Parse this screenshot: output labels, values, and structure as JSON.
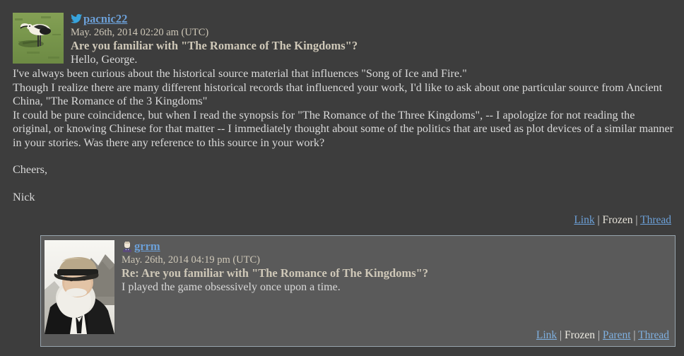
{
  "theme": {
    "page_background": "#3d3d3d",
    "reply_background": "#5a5a5a",
    "reply_border": "#97a4ad",
    "link_color": "#6ca0d8",
    "text_color": "#d9d9d9",
    "meta_color": "#cfc8b8"
  },
  "top_comment": {
    "avatar_alt": "bird-on-grass-userpic",
    "user_icon": "twitter-bird-icon",
    "username": "pacnic22",
    "datetime": "May. 26th, 2014 02:20 am (UTC)",
    "subject": "Are you familiar with \"The Romance of The Kingdoms\"?",
    "greeting": "Hello, George.",
    "body_lines": [
      "I've always been curious about the historical source material that influences \"Song of Ice and Fire.\"",
      "Though I realize there are many different historical records that influenced your work, I'd like to ask about one particular source from Ancient China, \"The Romance of the 3 Kingdoms\"",
      "It could be pure coincidence, but when I read the synopsis for \"The Romance of the Three Kingdoms\", -- I apologize for not reading the original, or knowing Chinese for that matter -- I immediately thought about some of the politics that are used as plot devices of a similar manner in your stories. Was there any reference to this source in your work?"
    ],
    "signoff": "Cheers,",
    "signature": "Nick",
    "links": {
      "link": "Link",
      "frozen": "Frozen",
      "thread": "Thread",
      "separator": "|"
    }
  },
  "reply_comment": {
    "avatar_alt": "bearded-man-in-cap-userpic",
    "user_icon": "lj-user-person-icon",
    "username": "grrm",
    "datetime": "May. 26th, 2014 04:19 pm (UTC)",
    "subject": "Re: Are you familiar with \"The Romance of The Kingdoms\"?",
    "body": "I played the game obsessively once upon a time.",
    "links": {
      "link": "Link",
      "frozen": "Frozen",
      "parent": "Parent",
      "thread": "Thread",
      "separator": "|"
    }
  }
}
